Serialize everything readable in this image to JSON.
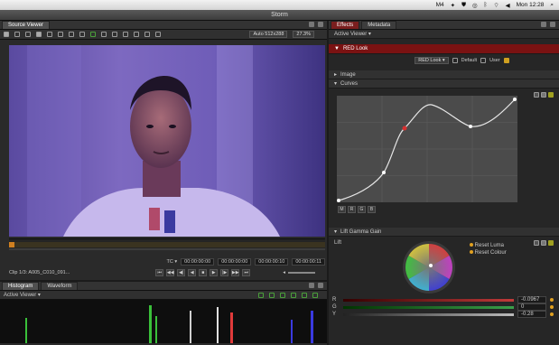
{
  "menubar": {
    "items": [
      "M4",
      "Mon 12:28"
    ]
  },
  "window": {
    "title": "Storm"
  },
  "source_viewer": {
    "tab_label": "Source Viewer",
    "resolution_label": "Auto 512x288",
    "zoom_label": "27.3%"
  },
  "timeline": {
    "tc_label": "TC ▾",
    "tc_in": "00:00:00:00",
    "tc_current": "00:00:00:00",
    "tc_duration": "00:00:00:10",
    "tc_end": "00:00:00:11",
    "clip_label": "Clip 1/3: A005_C010_091..."
  },
  "scopes": {
    "tabs": [
      "Histogram",
      "Waveform"
    ],
    "active_viewer_label": "Active Viewer ▾"
  },
  "effects": {
    "tabs": [
      "Effects",
      "Metadata"
    ],
    "active_viewer_label": "Active Viewer ▾",
    "look_header": "RED Look",
    "look_select": "RED Look ▾",
    "default_label": "Default",
    "user_label": "User",
    "image_label": "Image",
    "curves_label": "Curves",
    "curve_buttons": [
      "M",
      "R",
      "G",
      "B"
    ],
    "lgg_label": "Lift Gamma Gain",
    "lift_label": "Lift",
    "reset_luma": "Reset Luma",
    "reset_colour": "Reset Colour",
    "sliders": [
      {
        "label": "R",
        "value": "-0.0967",
        "color": "#c23a3a"
      },
      {
        "label": "G",
        "value": "0",
        "color": "#3aa04a"
      },
      {
        "label": "Y",
        "value": "-0.28",
        "color": "#bbbbbb"
      }
    ],
    "accent": "#7a1212"
  }
}
